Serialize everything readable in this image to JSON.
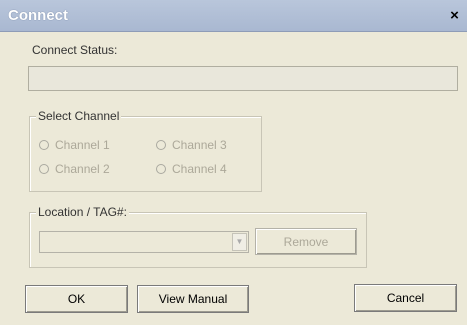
{
  "window": {
    "title": "Connect",
    "close_glyph": "×"
  },
  "connect_status": {
    "label": "Connect Status:",
    "value": ""
  },
  "select_channel": {
    "legend": "Select Channel",
    "channels": [
      "Channel 1",
      "Channel 2",
      "Channel 3",
      "Channel 4"
    ]
  },
  "location": {
    "legend": "Location / TAG#:",
    "dropdown_value": "",
    "remove_label": "Remove"
  },
  "buttons": {
    "ok": "OK",
    "view_manual": "View Manual",
    "cancel": "Cancel"
  },
  "icons": {
    "close": "close-icon",
    "dropdown_arrow": "chevron-down-icon"
  },
  "colors": {
    "title_bar": "#b9c6db",
    "dialog_bg": "#ece9d8",
    "disabled_text": "#aca899"
  }
}
